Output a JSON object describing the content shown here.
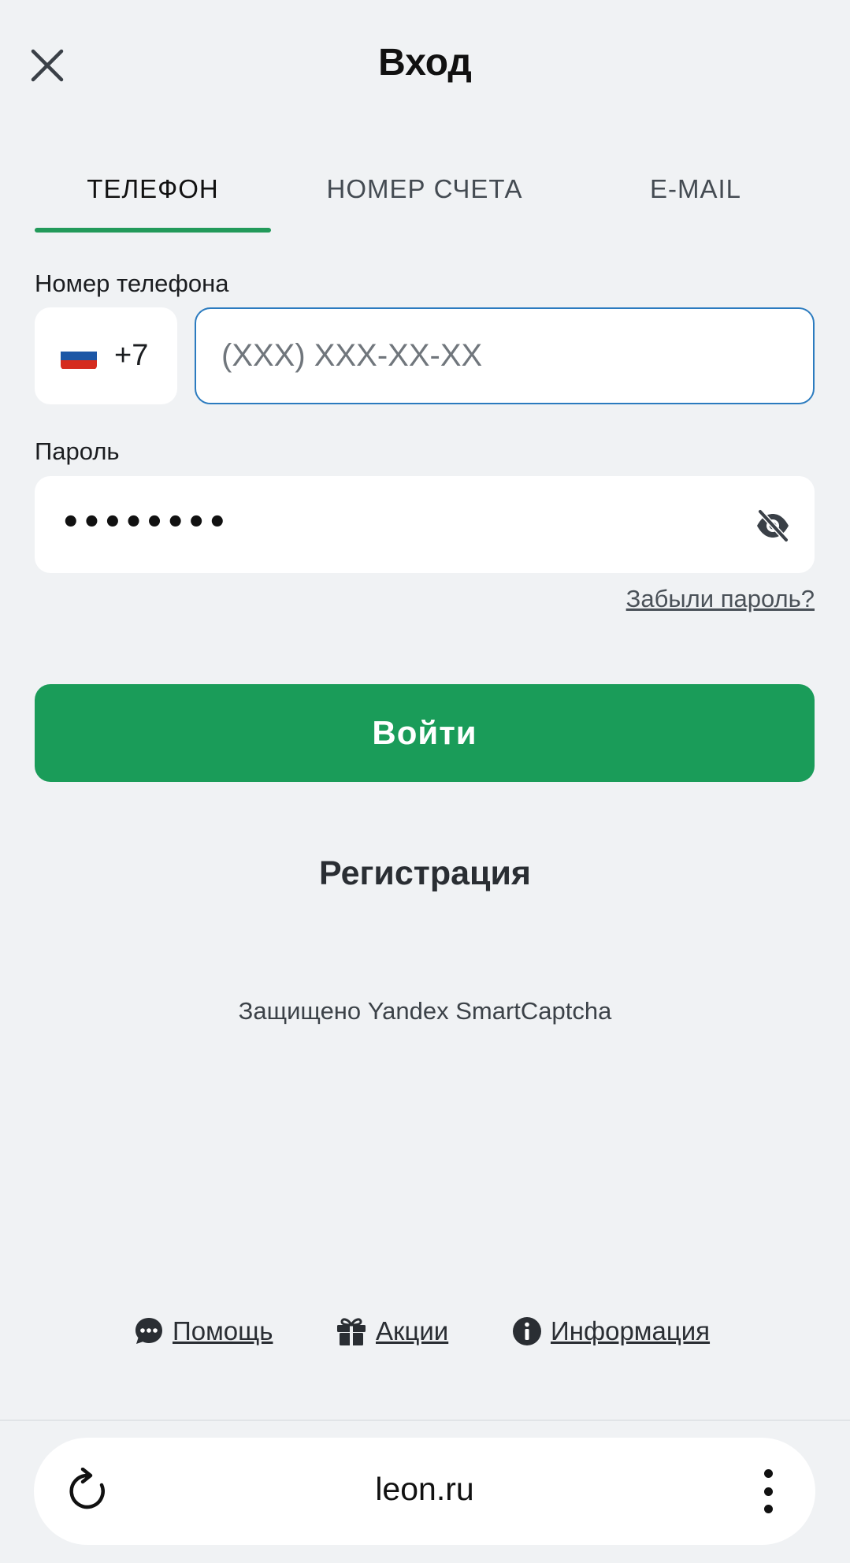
{
  "header": {
    "title": "Вход"
  },
  "tabs": [
    {
      "label": "ТЕЛЕФОН",
      "active": true
    },
    {
      "label": "НОМЕР СЧЕТА",
      "active": false
    },
    {
      "label": "E-MAIL",
      "active": false
    }
  ],
  "phone": {
    "label": "Номер телефона",
    "country_code": "+7",
    "placeholder": "(XXX) XXX-XX-XX",
    "value": ""
  },
  "password": {
    "label": "Пароль",
    "masked_value": "••••••••",
    "forgot_link": "Забыли пароль?"
  },
  "actions": {
    "login_label": "Войти",
    "register_label": "Регистрация"
  },
  "captcha_text": "Защищено Yandex SmartCaptcha",
  "footer": {
    "help": "Помощь",
    "promotions": "Акции",
    "info": "Информация"
  },
  "browser": {
    "url": "leon.ru"
  },
  "colors": {
    "accent": "#1a9c59",
    "tab_indicator": "#229a5a",
    "input_focus_border": "#2b7bbf",
    "background": "#f0f2f4"
  },
  "icons": {
    "close": "close-icon",
    "flag": "russia-flag-icon",
    "eye": "eye-off-icon",
    "help": "chat-icon",
    "promotions": "gift-icon",
    "info": "info-icon",
    "reload": "reload-icon",
    "menu": "more-vertical-icon"
  }
}
